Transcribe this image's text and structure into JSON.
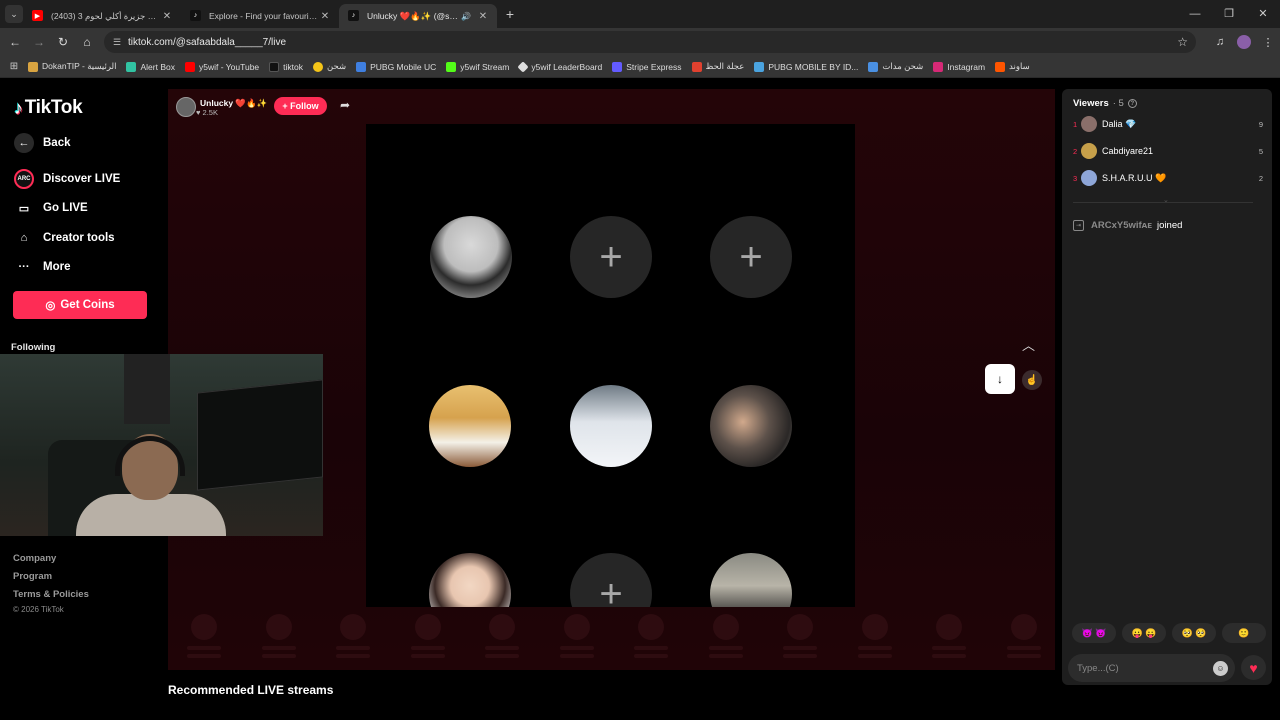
{
  "browser": {
    "tabs": [
      {
        "title": "(2403) 3 أيام في جزيرة أكلي لحوم"
      },
      {
        "title": "Explore - Find your favourite vi"
      },
      {
        "title": "Unlucky ❤️🔥✨ (@safaab"
      }
    ],
    "url": "tiktok.com/@safaabdala_____7/live",
    "bookmarks": [
      {
        "label": "DokanTIP - الرئيسية",
        "color": "#d9a441"
      },
      {
        "label": "Alert Box",
        "color": "#31c3a2"
      },
      {
        "label": "y5wif - YouTube",
        "color": "#ff0000"
      },
      {
        "label": "tiktok",
        "color": "#111111"
      },
      {
        "label": "شحن",
        "color": "#f5c518"
      },
      {
        "label": "PUBG Mobile UC",
        "color": "#3f7fe0"
      },
      {
        "label": "y5wif Stream",
        "color": "#53fc18"
      },
      {
        "label": "y5wif LeaderBoard",
        "color": "#dddddd"
      },
      {
        "label": "Stripe Express",
        "color": "#635bff"
      },
      {
        "label": "عجلة الحظ",
        "color": "#e0412f"
      },
      {
        "label": "PUBG MOBILE BY ID...",
        "color": "#4aa3df"
      },
      {
        "label": "شحن مدات",
        "color": "#4a90e2"
      },
      {
        "label": "Instagram",
        "color": "#d62976"
      },
      {
        "label": "ساوند",
        "color": "#ff5500"
      }
    ]
  },
  "sidebar": {
    "logo": "TikTok",
    "back": "Back",
    "discover": "Discover LIVE",
    "golive": "Go LIVE",
    "creator": "Creator tools",
    "more": "More",
    "coins": "Get Coins",
    "following": "Following",
    "footer": {
      "company": "Company",
      "program": "Program",
      "terms": "Terms & Policies",
      "copyright": "© 2026 TikTok"
    }
  },
  "live": {
    "host_name": "Unlucky ❤️🔥✨",
    "host_likes": "♥ 2.5K",
    "follow": "+ Follow",
    "recommended": "Recommended LIVE streams"
  },
  "panel": {
    "viewers_label": "Viewers",
    "viewers_count": "· 5",
    "viewers": [
      {
        "rank": "1",
        "name": "Dalia 💎",
        "score": "9",
        "color": "#8a6f6a"
      },
      {
        "rank": "2",
        "name": "Cabdiyare21",
        "score": "5",
        "color": "#c7a04a"
      },
      {
        "rank": "3",
        "name": "S.H.A.R.U.U 🧡",
        "score": "2",
        "color": "#8ea6d8"
      }
    ],
    "joined_name": "ARCxY5wifᴀᴇ",
    "joined_text": "joined",
    "emojis": [
      "😈 😈",
      "😛 😛",
      "🥺 🥺",
      "🙂"
    ],
    "input_placeholder": "Type...(C)"
  }
}
